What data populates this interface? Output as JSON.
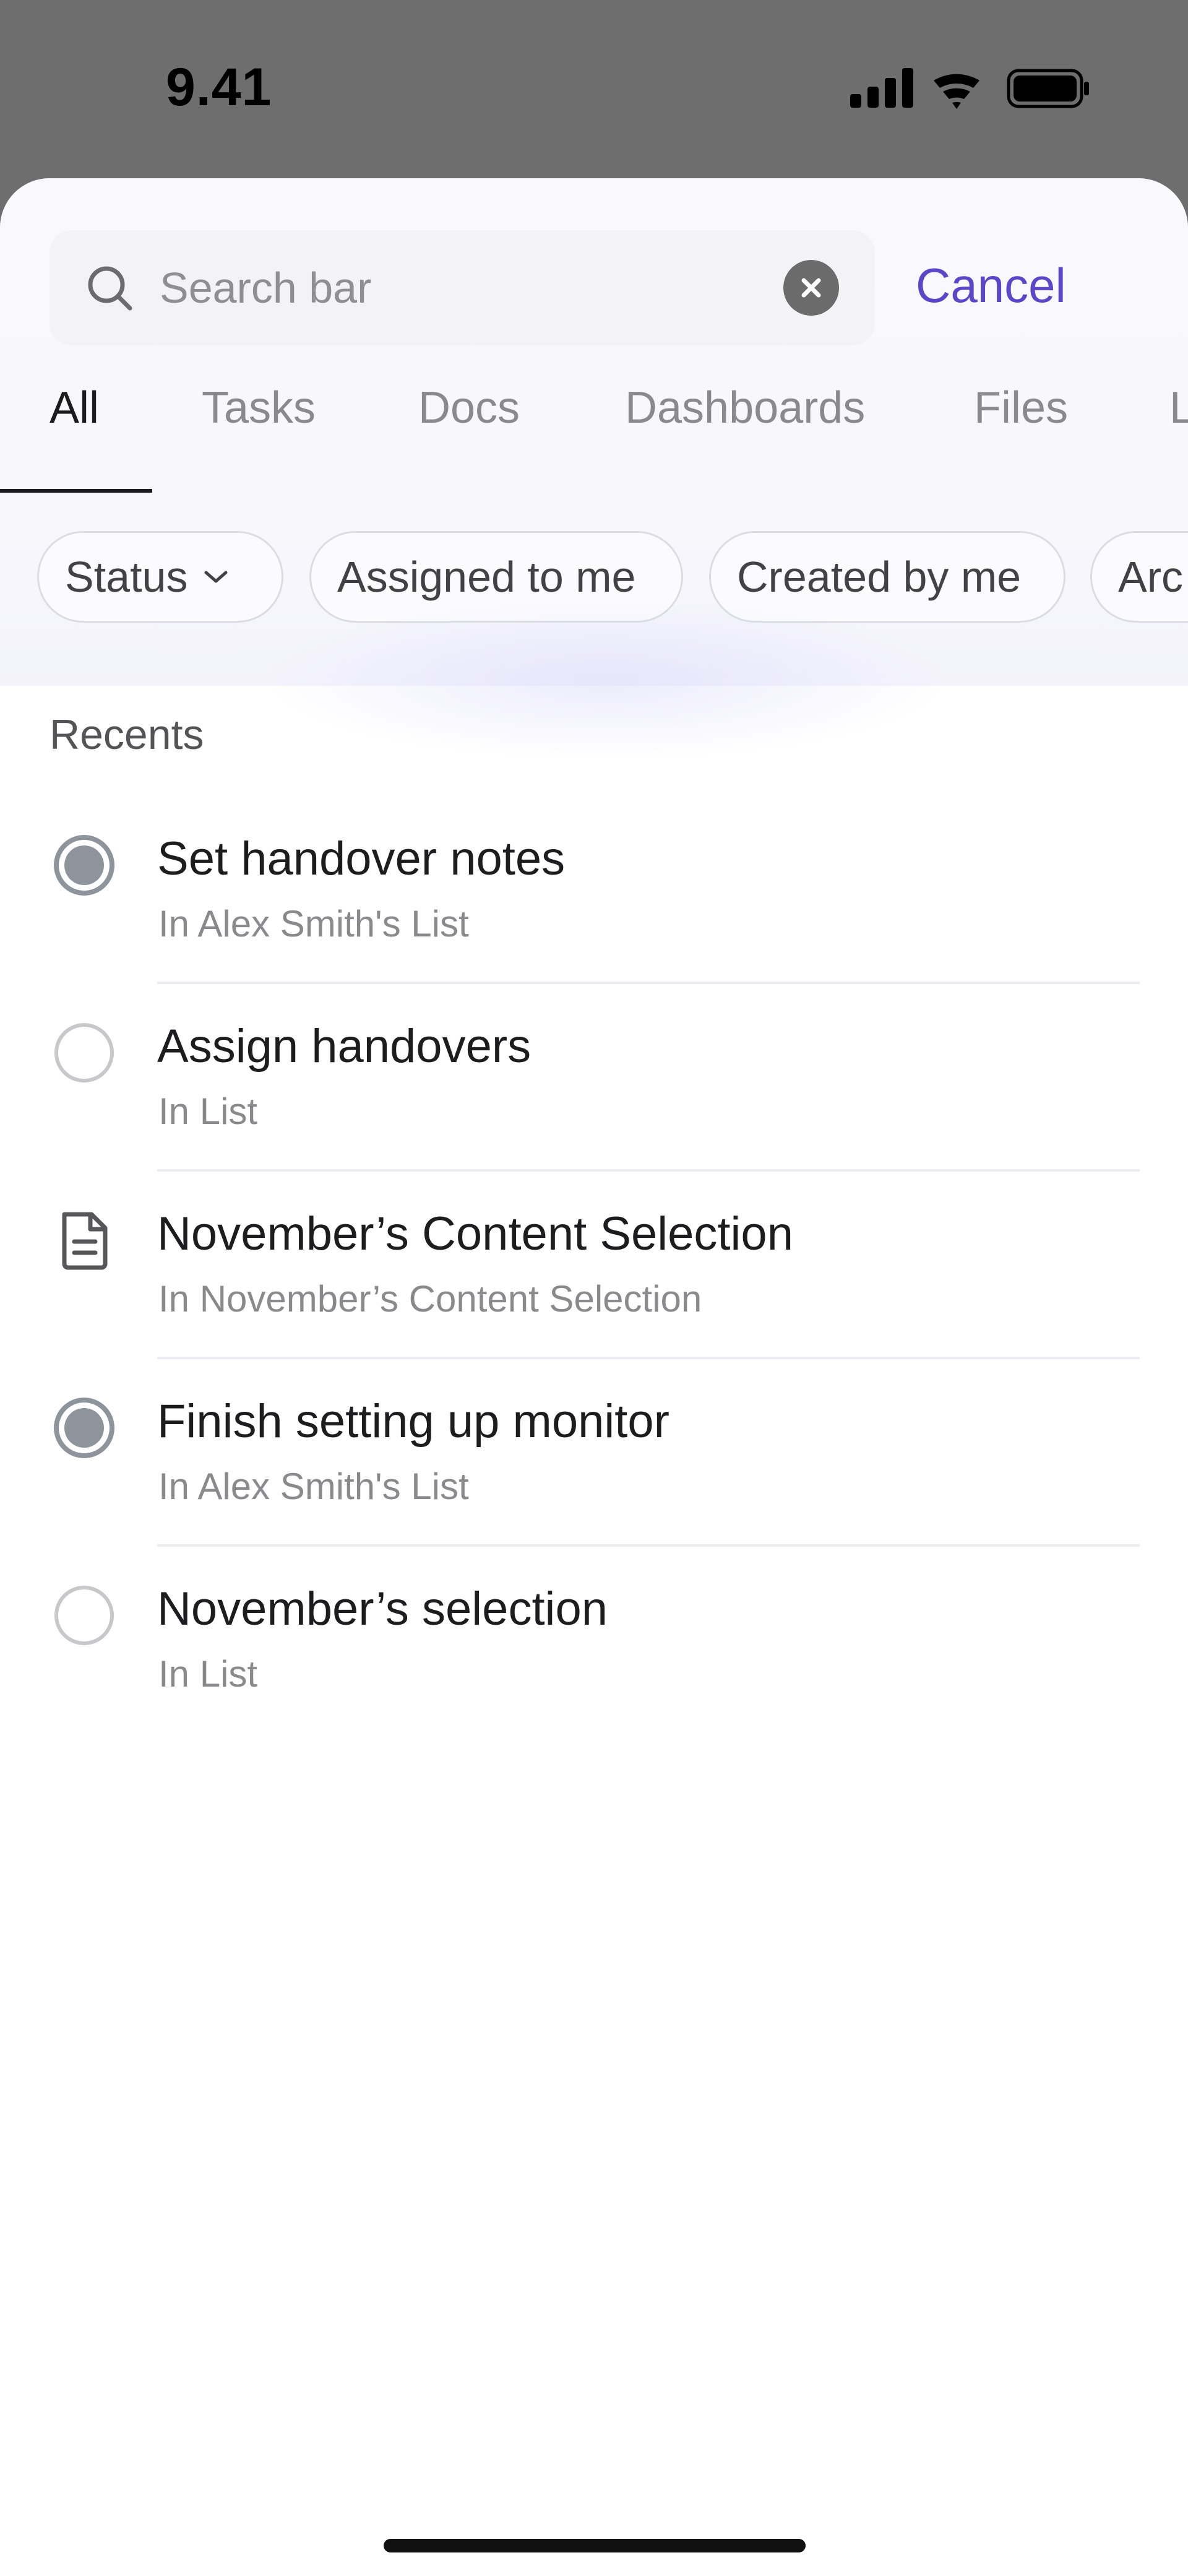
{
  "status_bar": {
    "time": "9.41",
    "icons": [
      "cellular-signal-icon",
      "wifi-icon",
      "battery-icon"
    ]
  },
  "search": {
    "placeholder": "Search bar",
    "value": "",
    "clear_icon": "clear-icon",
    "cancel_label": "Cancel"
  },
  "tabs": [
    {
      "label": "All",
      "active": true
    },
    {
      "label": "Tasks",
      "active": false
    },
    {
      "label": "Docs",
      "active": false
    },
    {
      "label": "Dashboards",
      "active": false
    },
    {
      "label": "Files",
      "active": false
    },
    {
      "label": "L",
      "active": false
    }
  ],
  "filters": [
    {
      "label": "Status",
      "has_dropdown": true
    },
    {
      "label": "Assigned to me",
      "has_dropdown": false
    },
    {
      "label": "Created by me",
      "has_dropdown": false
    },
    {
      "label": "Arc",
      "has_dropdown": false
    }
  ],
  "recents": {
    "heading": "Recents",
    "items": [
      {
        "title": "Set handover notes",
        "subtitle": "In Alex Smith's List",
        "icon": "task-status-in-progress-icon"
      },
      {
        "title": "Assign handovers",
        "subtitle": "In List",
        "icon": "task-status-todo-icon"
      },
      {
        "title": "November’s Content Selection",
        "subtitle": "In November’s Content Selection",
        "icon": "document-icon"
      },
      {
        "title": "Finish setting up monitor",
        "subtitle": "In Alex Smith's List",
        "icon": "task-status-in-progress-icon"
      },
      {
        "title": "November’s selection",
        "subtitle": "In List",
        "icon": "task-status-todo-icon"
      }
    ]
  },
  "colors": {
    "accent": "#5b45c8",
    "backdrop": "#6e6e6e",
    "status_filled": "#8e949c"
  }
}
